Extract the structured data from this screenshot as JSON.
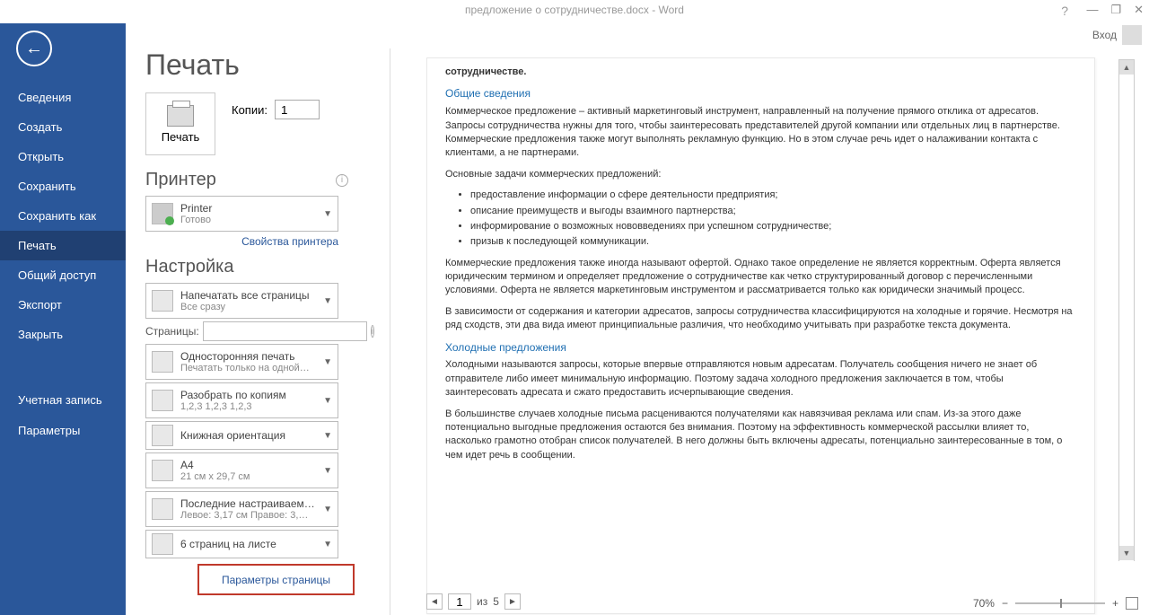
{
  "window": {
    "title": "предложение о сотрудничестве.docx - Word",
    "signin": "Вход"
  },
  "sidebar": {
    "items": [
      "Сведения",
      "Создать",
      "Открыть",
      "Сохранить",
      "Сохранить как",
      "Печать",
      "Общий доступ",
      "Экспорт",
      "Закрыть"
    ],
    "bottom": [
      "Учетная запись",
      "Параметры"
    ],
    "activeIndex": 5
  },
  "print": {
    "title": "Печать",
    "button": "Печать",
    "copies_label": "Копии:",
    "copies_value": "1"
  },
  "printer": {
    "header": "Принтер",
    "name": "Printer",
    "status": "Готово",
    "props_link": "Свойства принтера"
  },
  "settings": {
    "header": "Настройка",
    "pages_label": "Страницы:",
    "items": [
      {
        "main": "Напечатать все страницы",
        "sub": "Все сразу"
      },
      {
        "main": "Односторонняя печать",
        "sub": "Печатать только на одной…"
      },
      {
        "main": "Разобрать по копиям",
        "sub": "1,2,3   1,2,3   1,2,3"
      },
      {
        "main": "Книжная ориентация",
        "sub": ""
      },
      {
        "main": "A4",
        "sub": "21 см x 29,7 см"
      },
      {
        "main": "Последние настраиваемые…",
        "sub": "Левое:  3,17 см   Правое:  3,…"
      },
      {
        "main": "6 страниц на листе",
        "sub": ""
      }
    ],
    "page_setup": "Параметры страницы"
  },
  "pager": {
    "current": "1",
    "of_label": "из",
    "total": "5"
  },
  "zoom": {
    "value": "70%"
  },
  "doc": {
    "l0": "сотрудничестве.",
    "h1": "Общие сведения",
    "p1": "Коммерческое предложение – активный маркетинговый инструмент, направленный на получение прямого отклика от адресатов. Запросы сотрудничества нужны для того, чтобы заинтересовать представителей другой компании или отдельных лиц в партнерстве. Коммерческие предложения также могут выполнять рекламную функцию. Но в этом случае речь идет о налаживании контакта с клиентами, а не партнерами.",
    "p2": "Основные задачи коммерческих предложений:",
    "li1": "предоставление информации о сфере деятельности предприятия;",
    "li2": "описание преимуществ и выгоды взаимного партнерства;",
    "li3": "информирование о возможных нововведениях при успешном сотрудничестве;",
    "li4": "призыв к последующей коммуникации.",
    "p3": "Коммерческие предложения также иногда называют офертой. Однако такое определение не является корректным. Оферта является юридическим термином и определяет предложение о сотрудничестве как четко структурированный договор с перечисленными условиями. Оферта не является маркетинговым инструментом и рассматривается только как юридически значимый процесс.",
    "p4": "В зависимости от содержания и категории адресатов, запросы сотрудничества классифицируются на холодные и горячие. Несмотря на ряд сходств, эти два вида имеют принципиальные различия, что необходимо учитывать при разработке текста документа.",
    "h2": "Холодные предложения",
    "p5": "Холодными называются запросы, которые впервые отправляются новым адресатам. Получатель сообщения ничего не знает об отправителе либо имеет минимальную информацию. Поэтому задача холодного предложения заключается в том, чтобы заинтересовать адресата и сжато предоставить исчерпывающие сведения.",
    "p6": "В большинстве случаев холодные письма расцениваются получателями как навязчивая реклама или спам. Из-за этого даже потенциально выгодные предложения остаются без внимания. Поэтому на эффективность коммерческой рассылки влияет то, насколько грамотно отобран список получателей. В него должны быть включены адресаты, потенциально заинтересованные в том, о чем идет речь в сообщении."
  }
}
